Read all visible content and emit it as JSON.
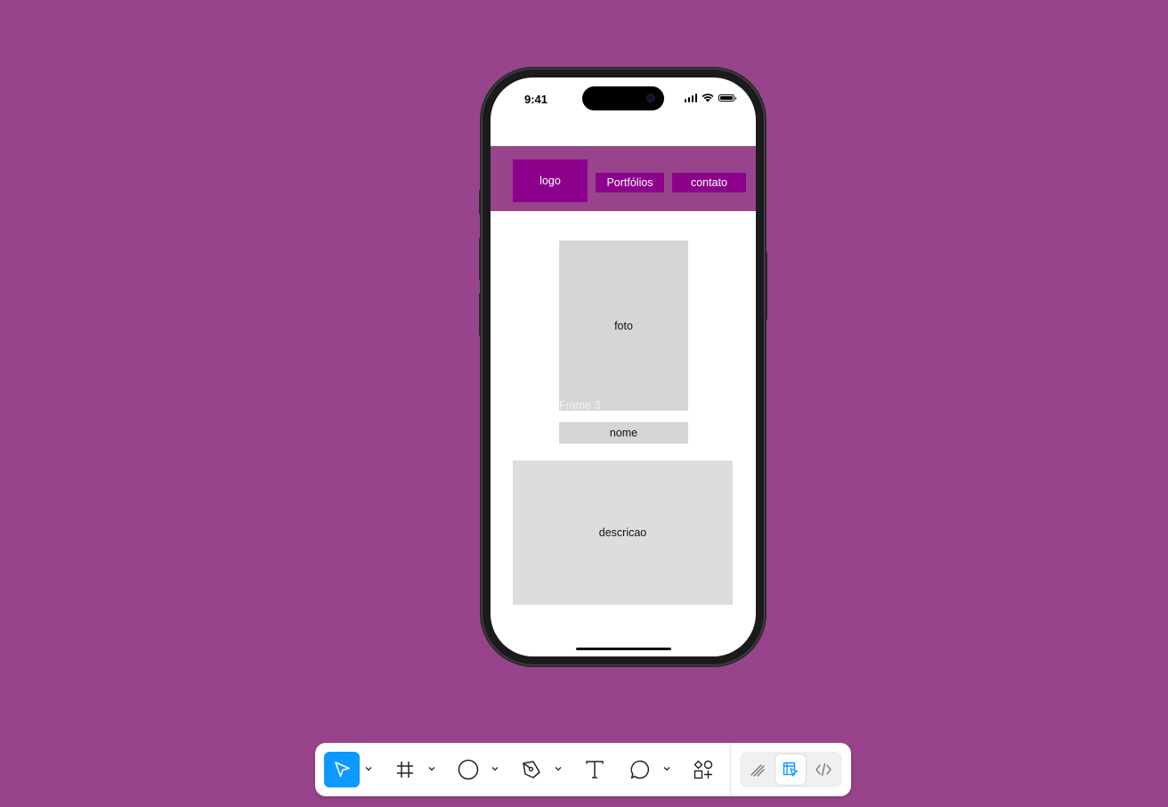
{
  "phone": {
    "status": {
      "time": "9:41"
    }
  },
  "header": {
    "logo": "logo",
    "nav": {
      "portfolios": "Portfólios",
      "contato": "contato"
    }
  },
  "content": {
    "foto": "foto",
    "frame_label": "Frame 3",
    "nome": "nome",
    "descricao": "descricao"
  },
  "toolbar": {
    "tools": [
      {
        "icon": "move-cursor-icon",
        "active": true
      },
      {
        "icon": "frame-icon",
        "active": false
      },
      {
        "icon": "ellipse-icon",
        "active": false
      },
      {
        "icon": "pen-icon",
        "active": false
      },
      {
        "icon": "text-icon",
        "active": false
      },
      {
        "icon": "comment-icon",
        "active": false
      },
      {
        "icon": "actions-icon",
        "active": false
      }
    ],
    "modes": [
      {
        "icon": "draw-mode-icon",
        "active": false
      },
      {
        "icon": "design-mode-icon",
        "active": true
      },
      {
        "icon": "dev-mode-icon",
        "active": false
      }
    ]
  },
  "colors": {
    "canvas": "#98448C",
    "nav_fill": "#8C008C",
    "placeholder": "#D6D6D6",
    "accent": "#0D99FF"
  }
}
